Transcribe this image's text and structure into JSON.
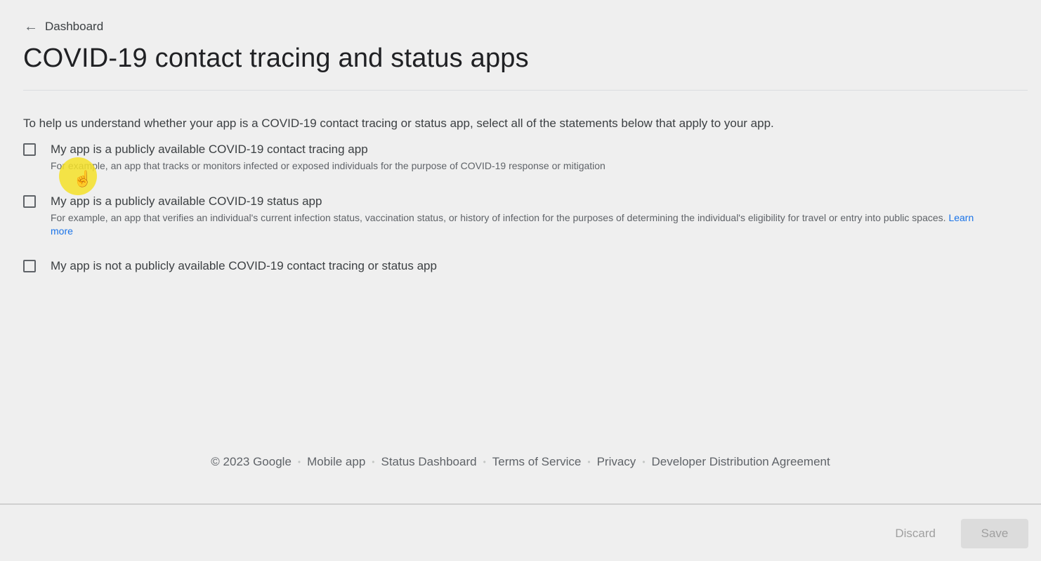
{
  "nav": {
    "back_arrow": "←",
    "back_label": "Dashboard"
  },
  "page": {
    "title": "COVID-19 contact tracing and status apps",
    "intro": "To help us understand whether your app is a COVID-19 contact tracing or status app, select all of the statements below that apply to your app."
  },
  "options": [
    {
      "label": "My app is a publicly available COVID-19 contact tracing app",
      "description": "For example, an app that tracks or monitors infected or exposed individuals for the purpose of COVID-19 response or mitigation",
      "checked": false
    },
    {
      "label": "My app is a publicly available COVID-19 status app",
      "description": "For example, an app that verifies an individual's current infection status, vaccination status, or history of infection for the purposes of determining the individual's eligibility for travel or entry into public spaces.",
      "link": "Learn more",
      "checked": false
    },
    {
      "label": "My app is not a publicly available COVID-19 contact tracing or status app",
      "checked": false
    }
  ],
  "footer": {
    "copyright": "© 2023 Google",
    "links": [
      "Mobile app",
      "Status Dashboard",
      "Terms of Service",
      "Privacy",
      "Developer Distribution Agreement"
    ],
    "separator": "•"
  },
  "actions": {
    "discard_label": "Discard",
    "save_label": "Save"
  },
  "cursor": {
    "glyph": "☝"
  },
  "colors": {
    "background": "#efefef",
    "link": "#1a73e8",
    "cursor_highlight": "#f5e128",
    "disabled_text": "#a0a0a0"
  }
}
